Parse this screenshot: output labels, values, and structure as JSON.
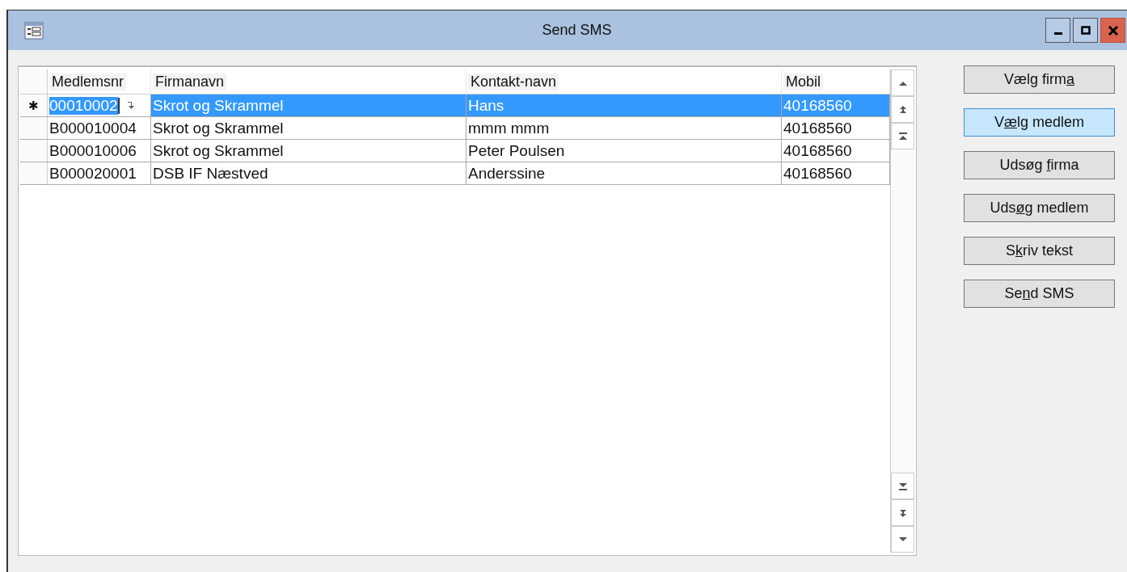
{
  "window": {
    "title": "Send SMS"
  },
  "table": {
    "columns": [
      "Medlemsnr",
      "Firmanavn",
      "Kontakt-navn",
      "Mobil"
    ],
    "rows": [
      {
        "marker": "✱",
        "selected": true,
        "editing": true,
        "cells": [
          "00010002",
          "Skrot og Skrammel",
          "Hans",
          "40168560"
        ]
      },
      {
        "selected": false,
        "editing": false,
        "cells": [
          "B000010004",
          "Skrot og Skrammel",
          "mmm mmm",
          "40168560"
        ]
      },
      {
        "selected": false,
        "editing": false,
        "cells": [
          "B000010006",
          "Skrot og Skrammel",
          "Peter Poulsen",
          "40168560"
        ]
      },
      {
        "selected": false,
        "editing": false,
        "cells": [
          "B000020001",
          "DSB IF Næstved",
          "Anderssine",
          "40168560"
        ]
      }
    ]
  },
  "buttons": [
    {
      "before": "Vælg firm",
      "key": "a",
      "focused": false
    },
    {
      "before": "V",
      "key": "æ",
      "after": "lg medlem",
      "focused": true
    },
    {
      "before": "Udsøg ",
      "key": "f",
      "after": "irma",
      "focused": false
    },
    {
      "before": "Uds",
      "key": "ø",
      "after": "g medlem",
      "focused": false
    },
    {
      "before": "S",
      "key": "k",
      "after": "riv tekst",
      "focused": false
    },
    {
      "before": "Se",
      "key": "n",
      "after": "d SMS",
      "focused": false
    }
  ]
}
